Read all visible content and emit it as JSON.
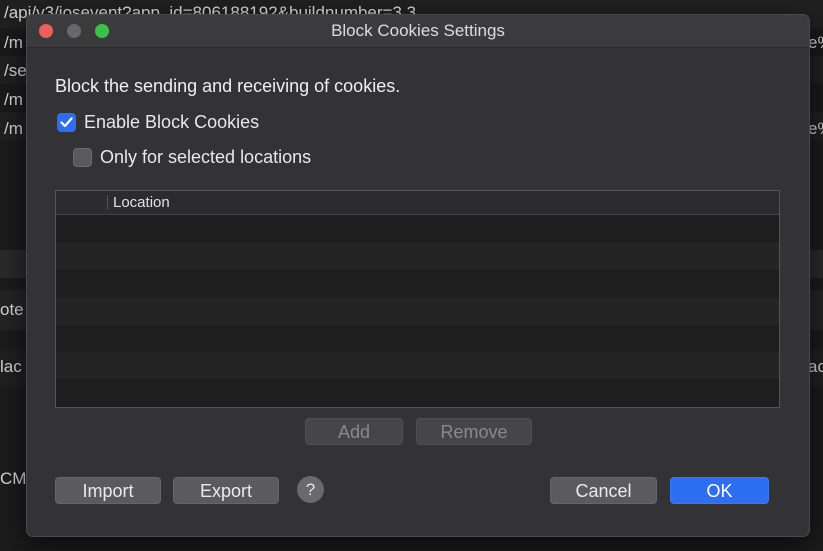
{
  "background": {
    "lines": [
      {
        "text": "/api/v3/iosevent?app_id=806188192&buildnumber=3.3"
      },
      {
        "text": "/m"
      },
      {
        "text": "e%"
      },
      {
        "text": "/se"
      },
      {
        "text": "/m"
      },
      {
        "text": "/m"
      },
      {
        "text": "e%"
      },
      {
        "text": "ote"
      },
      {
        "text": "lac"
      },
      {
        "text": "ac"
      },
      {
        "text": "CM_"
      }
    ]
  },
  "dialog": {
    "title": "Block Cookies Settings",
    "heading": "Block the sending and receiving of cookies.",
    "enable_checkbox": {
      "label": "Enable Block Cookies",
      "checked": true
    },
    "selected_checkbox": {
      "label": "Only for selected locations",
      "checked": false
    },
    "table": {
      "columns": [
        "Location"
      ],
      "rows": []
    },
    "buttons": {
      "add": "Add",
      "remove": "Remove",
      "import": "Import",
      "export": "Export",
      "help": "?",
      "cancel": "Cancel",
      "ok": "OK"
    }
  },
  "colors": {
    "accent": "#2e6ef3",
    "close": "#ec5f5a",
    "maximize": "#39c24a"
  }
}
